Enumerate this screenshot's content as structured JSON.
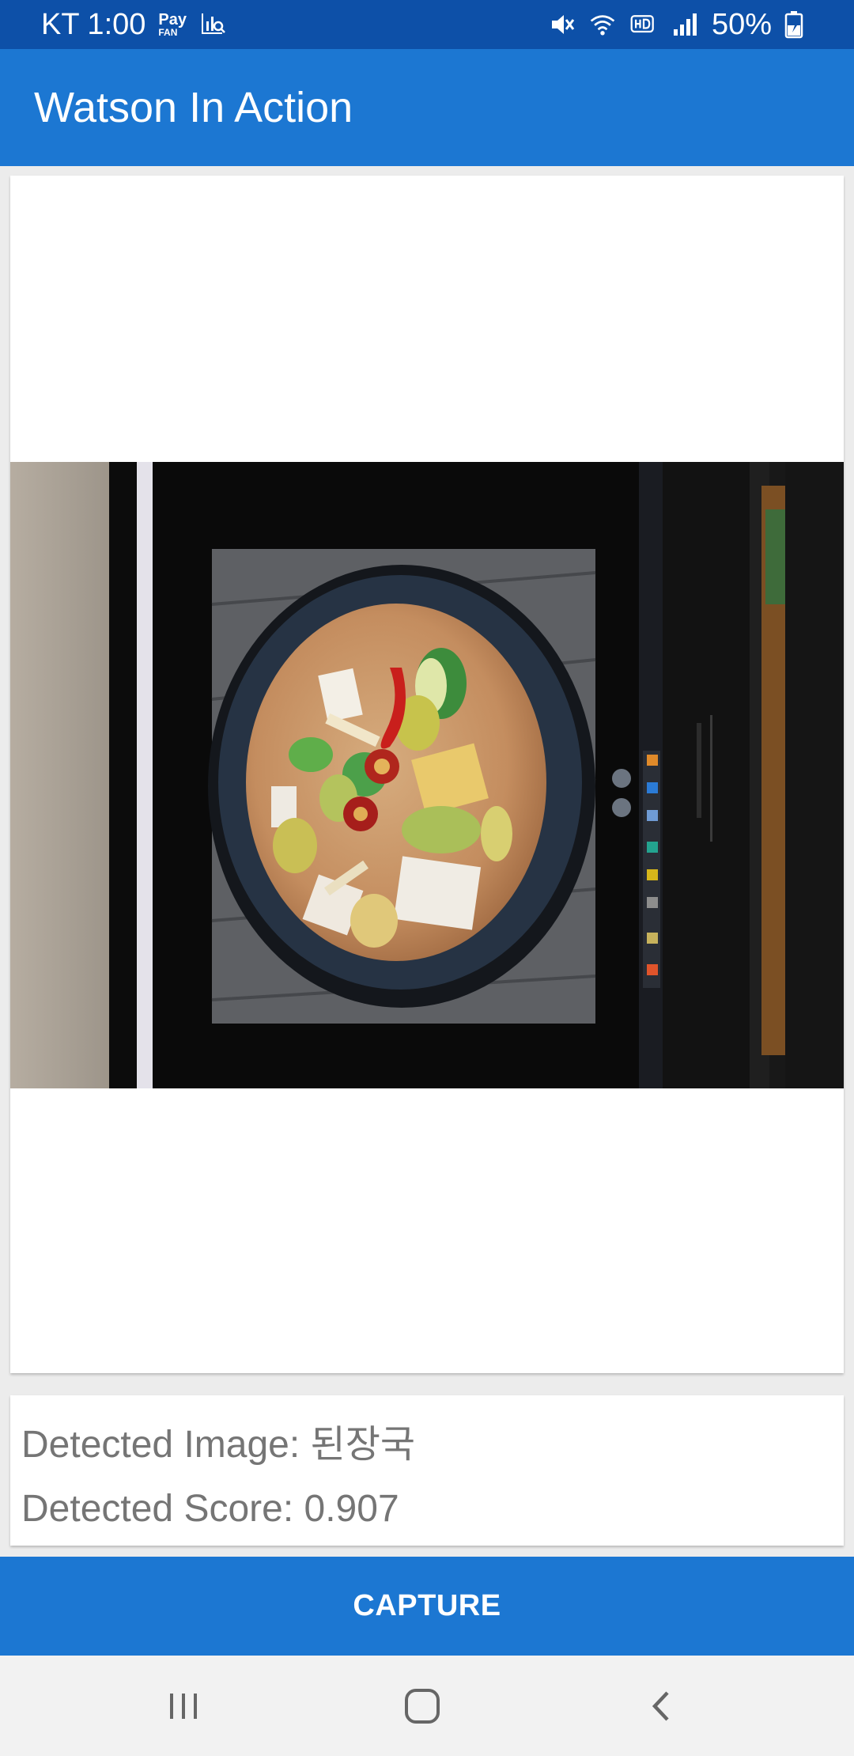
{
  "status_bar": {
    "carrier_time": "KT 1:00",
    "pay_top": "Pay",
    "pay_bottom": "FAN",
    "battery": "50%",
    "icons": [
      "pay-fan-icon",
      "stats-search-icon",
      "mute-icon",
      "wifi-icon",
      "hd-call-icon",
      "signal-icon",
      "battery-charging-icon"
    ]
  },
  "app_bar": {
    "title": "Watson In Action"
  },
  "result": {
    "detected_image": "Detected Image: 된장국",
    "detected_score": "Detected Score: 0.907"
  },
  "capture": {
    "label": "CAPTURE"
  },
  "nav": {
    "icons": [
      "recent-apps-icon",
      "home-icon",
      "back-icon"
    ]
  },
  "colors": {
    "status_bar": "#0d50a8",
    "primary": "#1c77d2",
    "result_text": "#757575",
    "nav_bar": "#f2f2f2"
  }
}
